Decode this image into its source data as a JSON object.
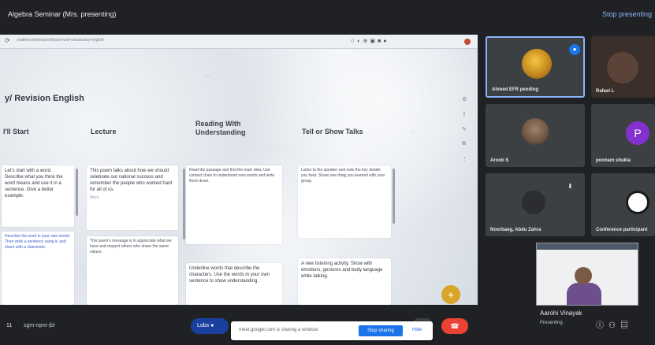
{
  "meeting": {
    "title": "Algebra Seminar (Mrs. presenting)",
    "stop_presenting": "Stop presenting"
  },
  "browser": {
    "url": "padlet.com/teacher/board-unit-vocabulary-english"
  },
  "padlet": {
    "board_title": "y/ Revision English",
    "columns": [
      {
        "title": "I'll Start"
      },
      {
        "title": "Lecture"
      },
      {
        "title": "Reading With Understanding"
      },
      {
        "title": "Tell or Show Talks"
      }
    ],
    "cards": {
      "c0a": "Let's start with a word. Describe what you think the word means and use it in a sentence. Give a better example.",
      "c0b": "Describe the word in your own words. Then write a sentence using it, and share with a classmate.",
      "c1a": "This poem talks about how we should celebrate our national success and remember the people who worked hard for all of us.",
      "c1b": "This poem's message is to appreciate what we have and respect others who share the same values.",
      "c1_more": "More",
      "c2a": "Read the passage and find the main idea. Use context clues to understand new words and write them down.",
      "c2b": "Underline words that describe the characters. Use the words in your own sentence to show understanding.",
      "c3a": "Listen to the speaker and note the key details you hear. Share one thing you learned with your group.",
      "c3b": "A new listening activity. Show with emotions, gestures and body language while talking."
    }
  },
  "participants": [
    {
      "name": "Ahmed EFR pending",
      "kind": "avatar-lion"
    },
    {
      "name": "Rafael L",
      "kind": "video"
    },
    {
      "name": "Aroob S",
      "kind": "avatar-photo"
    },
    {
      "name": "poonam shukla",
      "kind": "letter",
      "letter": "P"
    },
    {
      "name": "Noorbaeg, Abdu Zahra",
      "kind": "avatar-dark"
    },
    {
      "name": "Conference participant",
      "kind": "avatar-school"
    }
  ],
  "self_view": {
    "name": "Aarohi Vinayak",
    "subtitle": "Presenting"
  },
  "footer": {
    "time": "11",
    "meeting_code": "sgm-rqmr-jbl",
    "raise_label": "Lobs"
  },
  "share_notice": {
    "message": "meet.google.com is sharing a window.",
    "stop_button": "Stop sharing",
    "hide_button": "Hide"
  },
  "colors": {
    "meet_bg": "#1f2125",
    "accent_blue": "#1a73e8",
    "end_call_red": "#ea4335",
    "fab_gold": "#d8a529",
    "letter_avatar_purple": "#8430ce"
  }
}
